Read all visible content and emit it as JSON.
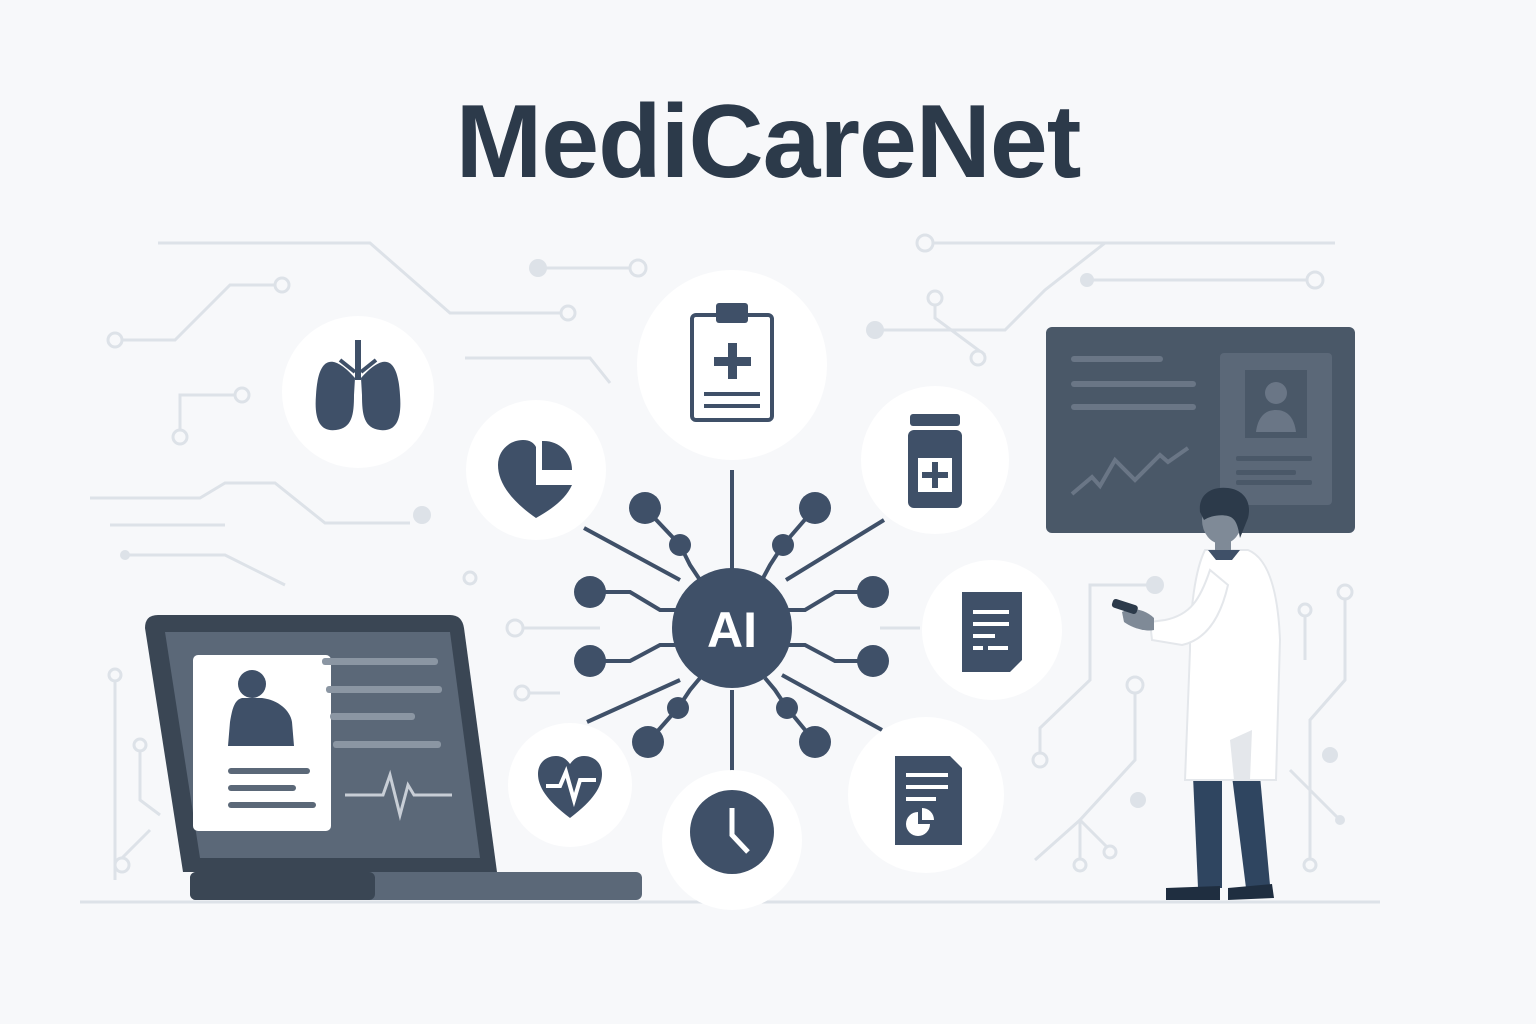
{
  "header": {
    "title": "MediCareNet"
  },
  "hub": {
    "label": "AI"
  },
  "icons": [
    "lungs-icon",
    "clipboard-medical-icon",
    "heart-chart-icon",
    "medicine-bottle-icon",
    "document-icon",
    "heart-pulse-icon",
    "clock-icon",
    "report-chart-icon"
  ],
  "colors": {
    "navy": "#2c3a4a",
    "slate": "#3f5068",
    "panel": "#4a5868",
    "panel_inner": "#5b6878",
    "circuit": "#dde2e8",
    "background": "#f7f8fa",
    "pants": "#2f4560",
    "coat": "#ffffff"
  }
}
